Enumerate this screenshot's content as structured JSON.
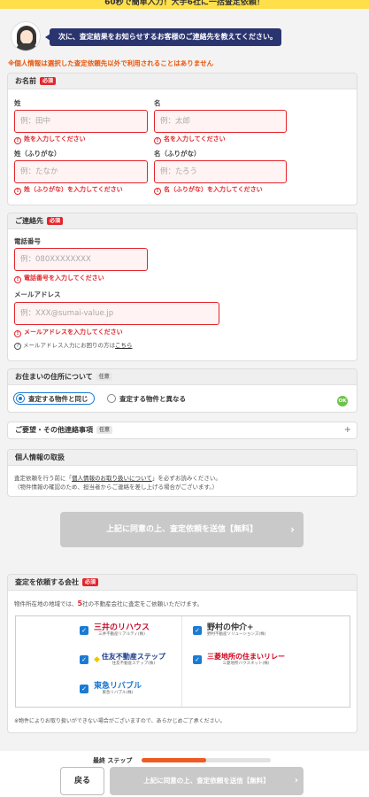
{
  "banner": {
    "text": "60秒で簡単入力！大手6社に一括査定依頼！"
  },
  "guide": {
    "message": "次に、査定結果をお知らせするお客様のご連絡先を教えてください。"
  },
  "privacy_note": "※個人情報は選択した査定依頼先以外で利用されることはありません",
  "name_section": {
    "title": "お名前",
    "required": "必須",
    "sei_label": "姓",
    "sei_placeholder": "例：田中",
    "sei_error": "姓を入力してください",
    "mei_label": "名",
    "mei_placeholder": "例：太郎",
    "mei_error": "名を入力してください",
    "sei_kana_label": "姓（ふりがな）",
    "sei_kana_placeholder": "例：たなか",
    "sei_kana_error": "姓（ふりがな）を入力してください",
    "mei_kana_label": "名（ふりがな）",
    "mei_kana_placeholder": "例：たろう",
    "mei_kana_error": "名（ふりがな）を入力してください"
  },
  "contact_section": {
    "title": "ご連絡先",
    "required": "必須",
    "phone_label": "電話番号",
    "phone_placeholder": "例：080XXXXXXXX",
    "phone_error": "電話番号を入力してください",
    "email_label": "メールアドレス",
    "email_placeholder": "例：XXX@sumai-value.jp",
    "email_error": "メールアドレスを入力してください",
    "help_text": "メールアドレス入力にお困りの方は",
    "help_link": "こちら"
  },
  "address_section": {
    "title": "お住まいの住所について",
    "badge": "任意",
    "option_same": "査定する物件と同じ",
    "option_diff": "査定する物件と異なる",
    "ok": "OK"
  },
  "requests_section": {
    "title": "ご要望・その他連絡事項",
    "badge": "任意",
    "expand": "+"
  },
  "personal_info_section": {
    "title": "個人情報の取扱",
    "line1_pre": "査定依頼を行う前に「",
    "line1_link": "個人情報のお取り扱いについて",
    "line1_post": "」を必ずお読みください。",
    "line2": "（物件情報の確認のため、担当者からご連絡を差し上げる場合がございます。）"
  },
  "submit_big": "上記に同意の上、査定依頼を送信【無料】",
  "companies_section": {
    "title": "査定を依頼する会社",
    "required": "必須",
    "intro_pre": "物件所在地の地域では、",
    "intro_count": "5",
    "intro_post": "社の不動産会社に査定をご依頼いただけます。",
    "companies": [
      {
        "name": "三井のリハウス",
        "sub": "三井不動産リアルティ(株)",
        "checked": true
      },
      {
        "name": "野村の仲介+",
        "sub": "野村不動産ソリューションズ(株)",
        "checked": true
      },
      {
        "name": "住友不動産ステップ",
        "sub": "住友不動産ステップ(株)",
        "checked": true
      },
      {
        "name": "三菱地所の住まいリレー",
        "sub": "三菱地所ハウスネット(株)",
        "checked": true
      },
      {
        "name": "東急リバブル",
        "sub": "東急リバブル(株)",
        "checked": true
      }
    ],
    "footnote": "※物件によりお取り扱いができない場合がございますので、あらかじめご了承ください。"
  },
  "footer": {
    "step_label": "最終 ステップ",
    "progress": 0.5,
    "back": "戻る",
    "submit": "上記に同意の上、査定依頼を送信【無料】"
  },
  "colors": {
    "accent": "#e3262c",
    "primary": "#1a7ad4",
    "navy": "#2a3570",
    "orange": "#ee5a24"
  }
}
